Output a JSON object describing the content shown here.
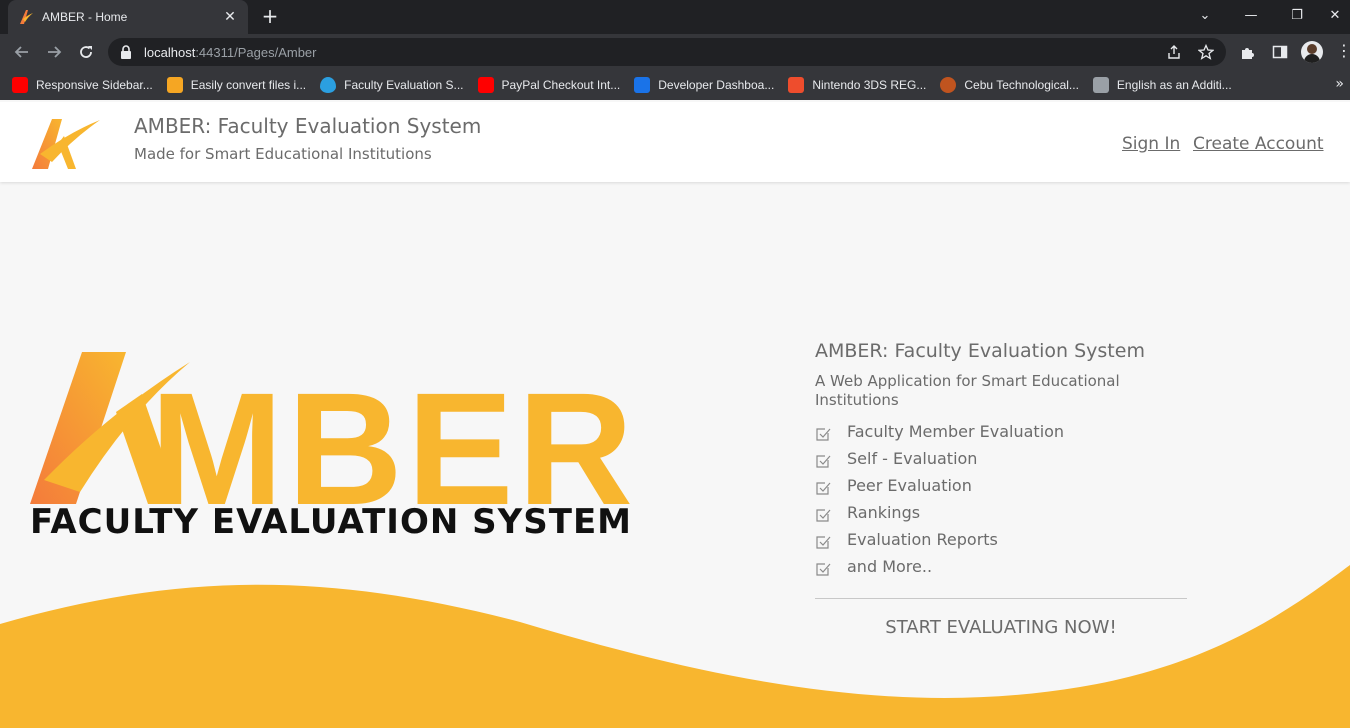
{
  "browser": {
    "tab_title": "AMBER - Home",
    "tab_close": "✕",
    "new_tab": "+",
    "url_host": "localhost",
    "url_path": ":44311/Pages/Amber",
    "window_controls": {
      "minimize": "—",
      "restore": "❐",
      "close": "✕",
      "tab_search": "⌄"
    },
    "bookmarks": [
      {
        "label": "Responsive Sidebar...",
        "icon": "youtube-icon",
        "color": "#ff0000"
      },
      {
        "label": "Easily convert files i...",
        "icon": "convert-icon",
        "color": "#f5a623"
      },
      {
        "label": "Faculty Evaluation S...",
        "icon": "drupal-icon",
        "color": "#2b9fe0"
      },
      {
        "label": "PayPal Checkout Int...",
        "icon": "youtube-icon",
        "color": "#ff0000"
      },
      {
        "label": "Developer Dashboa...",
        "icon": "paypal-icon",
        "color": "#1a73e8"
      },
      {
        "label": "Nintendo 3DS REG...",
        "icon": "shopee-icon",
        "color": "#ee4d2d"
      },
      {
        "label": "Cebu Technological...",
        "icon": "ctu-seal-icon",
        "color": "#c0541f"
      },
      {
        "label": "English as an Additi...",
        "icon": "library-icon",
        "color": "#9aa0a6"
      }
    ],
    "bookmarks_more": "»"
  },
  "header": {
    "title": "AMBER: Faculty Evaluation System",
    "subtitle": "Made for Smart Educational Institutions",
    "sign_in": "Sign In",
    "create_account": "Create Account"
  },
  "hero": {
    "logo_text": "AMBER",
    "tagline": "FACULTY EVALUATION SYSTEM"
  },
  "info": {
    "title": "AMBER: Faculty Evaluation System",
    "subtitle": "A Web Application for Smart Educational Institutions",
    "features": [
      "Faculty Member Evaluation",
      "Self - Evaluation",
      "Peer Evaluation",
      "Rankings",
      "Evaluation Reports",
      "and More.."
    ],
    "cta": "START EVALUATING NOW!"
  },
  "colors": {
    "accent": "#f8b62f",
    "accent_dark": "#f47b3b",
    "text_gray": "#6b6b6b"
  }
}
